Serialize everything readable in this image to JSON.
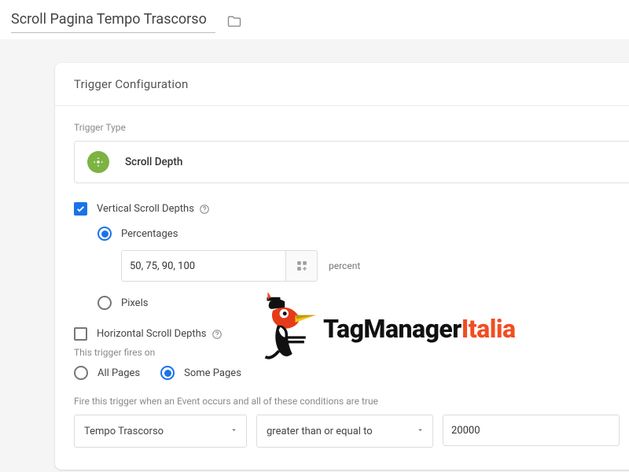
{
  "header": {
    "title": "Scroll Pagina Tempo Trascorso"
  },
  "card": {
    "title": "Trigger Configuration",
    "type_label": "Trigger Type",
    "type_value": "Scroll Depth",
    "vertical": {
      "label": "Vertical Scroll Depths",
      "percentages_label": "Percentages",
      "percentages_value": "50, 75, 90, 100",
      "unit": "percent",
      "pixels_label": "Pixels"
    },
    "horizontal_label": "Horizontal Scroll Depths",
    "fires_label": "This trigger fires on",
    "all_pages": "All Pages",
    "some_pages": "Some Pages",
    "cond_label": "Fire this trigger when an Event occurs and all of these conditions are true",
    "condition": {
      "variable": "Tempo Trascorso",
      "operator": "greater than or equal to",
      "value": "20000"
    }
  },
  "logo": {
    "tm": "TagManager",
    "it": "Italia"
  }
}
